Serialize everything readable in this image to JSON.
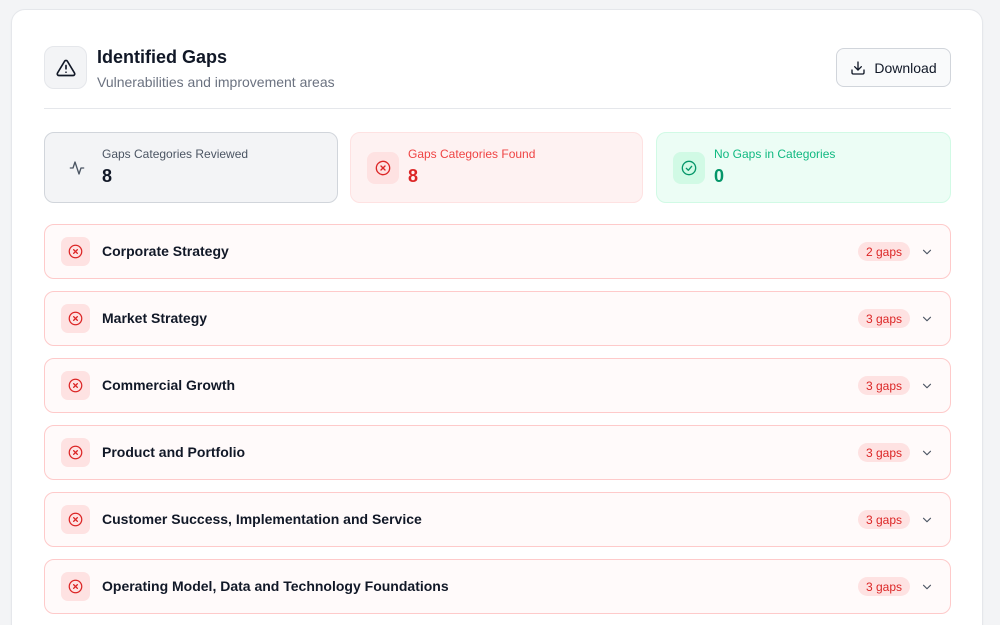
{
  "header": {
    "title": "Identified Gaps",
    "subtitle": "Vulnerabilities and improvement areas",
    "icon": "warning-triangle-icon",
    "download_label": "Download"
  },
  "stats": [
    {
      "label": "Gaps Categories Reviewed",
      "value": "8",
      "icon": "activity-icon"
    },
    {
      "label": "Gaps Categories Found",
      "value": "8",
      "icon": "x-circle-icon"
    },
    {
      "label": "No Gaps in Categories",
      "value": "0",
      "icon": "check-circle-icon"
    }
  ],
  "categories": [
    {
      "name": "Corporate Strategy",
      "gaps": "2 gaps"
    },
    {
      "name": "Market Strategy",
      "gaps": "3 gaps"
    },
    {
      "name": "Commercial Growth",
      "gaps": "3 gaps"
    },
    {
      "name": "Product and Portfolio",
      "gaps": "3 gaps"
    },
    {
      "name": "Customer Success, Implementation and Service",
      "gaps": "3 gaps"
    },
    {
      "name": "Operating Model, Data and Technology Foundations",
      "gaps": "3 gaps"
    }
  ],
  "colors": {
    "gap_red": "#dc2626",
    "success_green": "#059669",
    "neutral_gray": "#6b7280"
  }
}
